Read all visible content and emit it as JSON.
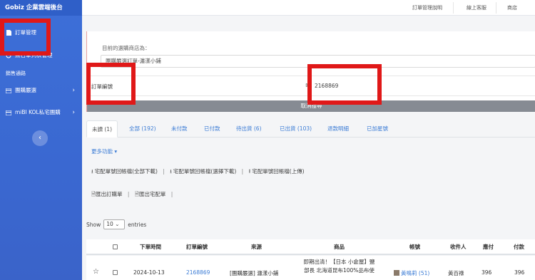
{
  "sidebar": {
    "brand": "Gobiz 企業雲端後台",
    "items": [
      {
        "label": "訂單管理",
        "icon": "document-icon"
      },
      {
        "label": "無名單列表管理",
        "icon": "circle-icon"
      }
    ],
    "section_title": "銷售通路",
    "groups": [
      {
        "label": "團購嚴選",
        "icon": "list-icon"
      },
      {
        "label": "miBI KOL私宅團購",
        "icon": "list-icon"
      }
    ],
    "collapse_glyph": "‹"
  },
  "topnav": {
    "links": [
      "訂單管理說明",
      "線上客服",
      "商店"
    ]
  },
  "filter": {
    "store_label": "目前的選購商店為：",
    "store_value": "團購嚴選訂單-瀍漾小鋪",
    "field_label": "訂單編號",
    "field_value": "2168869",
    "cancel_search": "取消搜尋"
  },
  "tabs": [
    {
      "label": "未讀 (1)",
      "active": true
    },
    {
      "label": "全部 (192)"
    },
    {
      "label": "未付款"
    },
    {
      "label": "已付款"
    },
    {
      "label": "待出貨 (6)"
    },
    {
      "label": "已出貨 (103)"
    },
    {
      "label": "退款明細"
    },
    {
      "label": "已加星號"
    }
  ],
  "more_functions": "更多功能",
  "shipping_actions": [
    "宅配單號回帳檔(全部下載)",
    "宅配單號回帳檔(選擇下載)",
    "宅配單號回帳檔(上傳)"
  ],
  "export_actions": [
    "匯出訂購單",
    "匯出宅配單"
  ],
  "show_entries": {
    "prefix": "Show",
    "value": "10",
    "suffix": "entries"
  },
  "table": {
    "headers": [
      "下單時間",
      "訂單編號",
      "來源",
      "商品",
      "帳號",
      "收件人",
      "應付",
      "付款"
    ],
    "row": {
      "date": "2024-10-13",
      "order_no": "2168869",
      "source": "[團購嚴選] 瀍漾小鋪",
      "product_line1": "即期出清！【日本 小倉屋】鹽",
      "product_line2": "部長 北海道昆布100%品布使",
      "account_name": "黃鳴莉",
      "account_count": "(51)",
      "recipient": "黃百祿",
      "payable": "396",
      "paid": "396"
    }
  },
  "colors": {
    "sidebar": "#3d6fd8",
    "accent": "#3a7bd5",
    "highlight": "#e01818"
  }
}
